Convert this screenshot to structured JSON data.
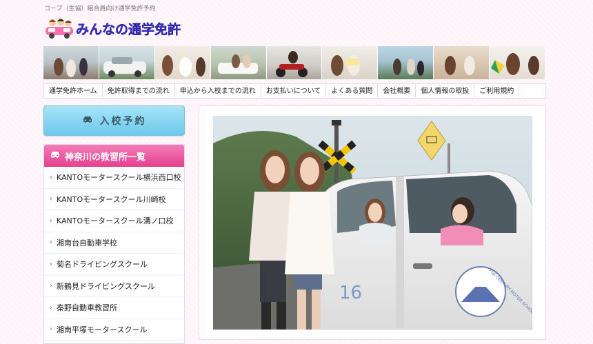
{
  "header": {
    "tagline": "コープ（生協）組合員向け通学免許予約",
    "logo_text": "みんなの通学免許"
  },
  "nav": {
    "items": [
      "通学免許ホーム",
      "免許取得までの流れ",
      "申込から入校までの流れ",
      "お支払いについて",
      "よくある質問",
      "会社概要",
      "個人情報の取扱",
      "ご利用規約"
    ]
  },
  "sidebar": {
    "reserve_label": "入校予約",
    "schools_title": "神奈川の教習所一覧",
    "schools": [
      "KANTOモータースクール横浜西口校",
      "KANTOモータースクール川崎校",
      "KANTOモータースクール溝ノ口校",
      "湘南台自動車学校",
      "菊名ドライビングスクール",
      "新鶴見ドライビングスクール",
      "秦野自動車教習所",
      "湘南平塚モータースクール"
    ]
  },
  "hero": {
    "car_number": "16",
    "school_logo_text": "FUJI CENTURY MOTOR SCHOOL"
  },
  "colors": {
    "accent_pink": "#e5408f",
    "button_blue": "#6cc8ea"
  },
  "icons": {
    "reserve": "car-icon",
    "schools": "car-icon",
    "list": "chevron-right-icon"
  }
}
